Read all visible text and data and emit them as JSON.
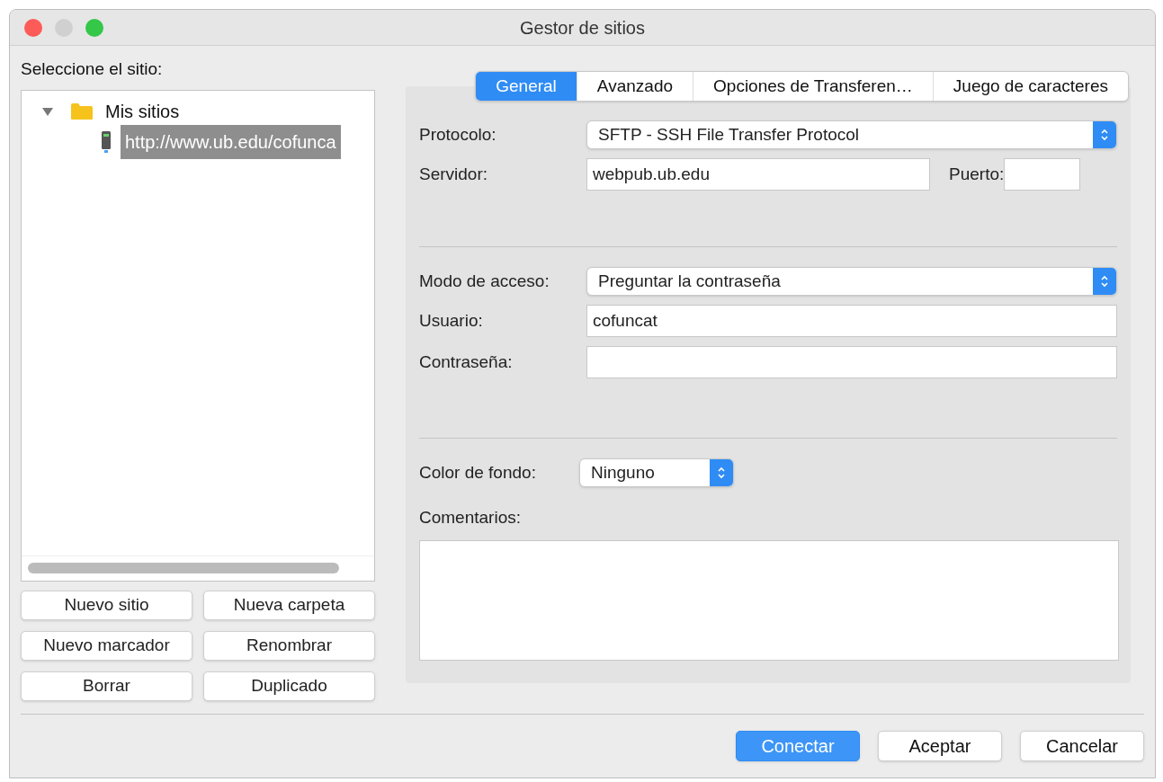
{
  "window": {
    "title": "Gestor de sitios"
  },
  "site_tree": {
    "label": "Seleccione el sitio:",
    "items": [
      {
        "kind": "folder",
        "label": "Mis sitios",
        "expanded": true,
        "selected": false,
        "children": [
          {
            "kind": "site",
            "label": "http://www.ub.edu/cofunca",
            "selected": true
          }
        ]
      }
    ]
  },
  "site_buttons": [
    "Nuevo sitio",
    "Nueva carpeta",
    "Nuevo marcador",
    "Renombrar",
    "Borrar",
    "Duplicado"
  ],
  "tabs": [
    {
      "label": "General",
      "selected": true
    },
    {
      "label": "Avanzado",
      "selected": false
    },
    {
      "label": "Opciones de Transferen…",
      "selected": false
    },
    {
      "label": "Juego de caracteres",
      "selected": false
    }
  ],
  "general": {
    "protocol": {
      "label": "Protocolo:",
      "value": "SFTP - SSH File Transfer Protocol"
    },
    "server": {
      "label": "Servidor:",
      "value": "webpub.ub.edu"
    },
    "port": {
      "label": "Puerto:"
    },
    "access_mode": {
      "label": "Modo de acceso:",
      "value": "Preguntar la contraseña"
    },
    "user": {
      "label": "Usuario:",
      "value": "cofuncat"
    },
    "password": {
      "label": "Contraseña:"
    },
    "background_color": {
      "label": "Color de fondo:",
      "value": "Ninguno"
    },
    "comments": {
      "label": "Comentarios:"
    }
  },
  "dialog_buttons": [
    {
      "label": "Conectar",
      "default": true
    },
    {
      "label": "Aceptar",
      "default": false
    },
    {
      "label": "Cancelar",
      "default": false
    }
  ]
}
